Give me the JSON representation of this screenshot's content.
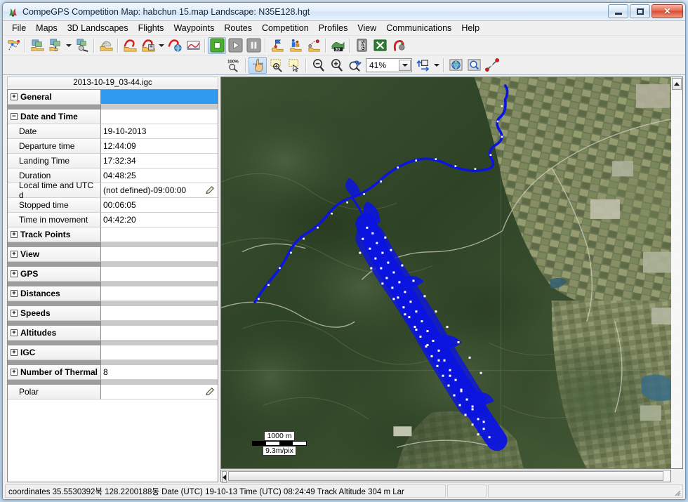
{
  "window": {
    "title": "CompeGPS Competition Map: habchun 15.map Landscape: N35E128.hgt",
    "app_icon": "compegps-logo-icon",
    "minimize_label": "Minimize",
    "maximize_label": "Maximize",
    "close_label": "✕"
  },
  "menu": [
    {
      "label": "File",
      "accel": "F"
    },
    {
      "label": "Maps",
      "accel": "M"
    },
    {
      "label": "3D Landscapes",
      "accel": "3"
    },
    {
      "label": "Flights",
      "accel": "l"
    },
    {
      "label": "Waypoints",
      "accel": "W"
    },
    {
      "label": "Routes",
      "accel": "R"
    },
    {
      "label": "Competition",
      "accel": "C"
    },
    {
      "label": "Profiles",
      "accel": "o"
    },
    {
      "label": "View",
      "accel": "V"
    },
    {
      "label": "Communications",
      "accel": "u"
    },
    {
      "label": "Help",
      "accel": "H"
    }
  ],
  "toolbar_main": [
    {
      "name": "new-track-icon",
      "tip": "New track"
    },
    {
      "name": "open-map-icon",
      "tip": "Open map"
    },
    {
      "name": "open-map-3d-icon",
      "tip": "Open 3D map"
    },
    {
      "name": "map-dropdown-caret",
      "tip": "Map options"
    },
    {
      "name": "map-tools-icon",
      "tip": "Map tools"
    },
    {
      "name": "open-landscape-icon",
      "tip": "Open landscape"
    },
    {
      "name": "open-flight-icon",
      "tip": "Open flight"
    },
    {
      "name": "save-flight-icon",
      "tip": "Save flight"
    },
    {
      "name": "flight-dropdown-caret",
      "tip": "Flight options"
    },
    {
      "name": "flight-globe-icon",
      "tip": "Flight on globe"
    },
    {
      "name": "graph-icon",
      "tip": "Flight graph"
    },
    {
      "name": "stop-animation-icon",
      "tip": "Stop"
    },
    {
      "name": "play-animation-icon",
      "tip": "Play"
    },
    {
      "name": "pause-animation-icon",
      "tip": "Pause"
    },
    {
      "name": "open-waypoints-icon",
      "tip": "Open waypoints"
    },
    {
      "name": "open-competition-icon",
      "tip": "Open competition"
    },
    {
      "name": "open-route-icon",
      "tip": "Open route"
    },
    {
      "name": "view-3d-icon",
      "tip": "3D view"
    },
    {
      "name": "gps-icon",
      "tip": "GPS"
    },
    {
      "name": "export-icon",
      "tip": "Export"
    },
    {
      "name": "magnet-track-icon",
      "tip": "Magnet"
    }
  ],
  "toolbar_view": {
    "zoom_100_label": "100%",
    "zoom_value": "41%",
    "buttons": [
      {
        "name": "zoom-100-icon",
        "tip": "Zoom 100%"
      },
      {
        "name": "pan-hand-icon",
        "tip": "Pan"
      },
      {
        "name": "zoom-window-icon",
        "tip": "Zoom window"
      },
      {
        "name": "select-rect-icon",
        "tip": "Select area"
      },
      {
        "name": "zoom-out-icon",
        "tip": "Zoom out"
      },
      {
        "name": "zoom-in-icon",
        "tip": "Zoom in"
      },
      {
        "name": "zoom-refresh-icon",
        "tip": "Zoom all"
      },
      {
        "name": "zoom-level-combo",
        "tip": "Zoom level"
      },
      {
        "name": "move-up-icon",
        "tip": "Move up"
      },
      {
        "name": "move-dropdown-caret",
        "tip": "Move options"
      },
      {
        "name": "globe-view-icon",
        "tip": "Globe view"
      },
      {
        "name": "magnifier-view-icon",
        "tip": "Magnifier"
      },
      {
        "name": "measure-icon",
        "tip": "Measure distance"
      }
    ]
  },
  "sidebar": {
    "file_tab": "2013-10-19_03-44.igc",
    "rows": [
      {
        "type": "group",
        "label": "General",
        "value": "",
        "expander": "+",
        "selected": true
      },
      {
        "type": "band"
      },
      {
        "type": "group",
        "label": "Date and Time",
        "value": "",
        "expander": "−"
      },
      {
        "type": "child",
        "label": "Date",
        "value": "19-10-2013"
      },
      {
        "type": "child",
        "label": "Departure time",
        "value": "12:44:09"
      },
      {
        "type": "child",
        "label": "Landing Time",
        "value": "17:32:34"
      },
      {
        "type": "child",
        "label": "Duration",
        "value": "04:48:25"
      },
      {
        "type": "child",
        "label": "Local time and UTC d",
        "value": "(not defined)-09:00:00",
        "pencil": true
      },
      {
        "type": "child",
        "label": "Stopped time",
        "value": "00:06:05"
      },
      {
        "type": "child",
        "label": "Time in movement",
        "value": "04:42:20"
      },
      {
        "type": "group",
        "label": "Track Points",
        "value": "",
        "expander": "+"
      },
      {
        "type": "band"
      },
      {
        "type": "group",
        "label": "View",
        "value": "",
        "expander": "+"
      },
      {
        "type": "band"
      },
      {
        "type": "group",
        "label": "GPS",
        "value": "",
        "expander": "+"
      },
      {
        "type": "band"
      },
      {
        "type": "group",
        "label": "Distances",
        "value": "",
        "expander": "+"
      },
      {
        "type": "band"
      },
      {
        "type": "group",
        "label": "Speeds",
        "value": "",
        "expander": "+"
      },
      {
        "type": "band"
      },
      {
        "type": "group",
        "label": "Altitudes",
        "value": "",
        "expander": "+"
      },
      {
        "type": "band"
      },
      {
        "type": "group",
        "label": "IGC",
        "value": "",
        "expander": "+"
      },
      {
        "type": "band"
      },
      {
        "type": "group",
        "label": "Number of Thermal",
        "value": "8",
        "expander": "+"
      },
      {
        "type": "band"
      },
      {
        "type": "child",
        "label": "Polar",
        "value": "",
        "pencil": true
      }
    ]
  },
  "map": {
    "scale_distance": "1000 m",
    "scale_resolution": "9.3m/pix",
    "track_color": "#0b14e0",
    "track_point_color": "#ffffff"
  },
  "statusbar": {
    "main": "coordinates 35.5530392북 128.2200188동 Date (UTC) 19-10-13 Time (UTC) 08:24:49 Track Altitude 304 m Lar",
    "middle": "",
    "right": ""
  }
}
